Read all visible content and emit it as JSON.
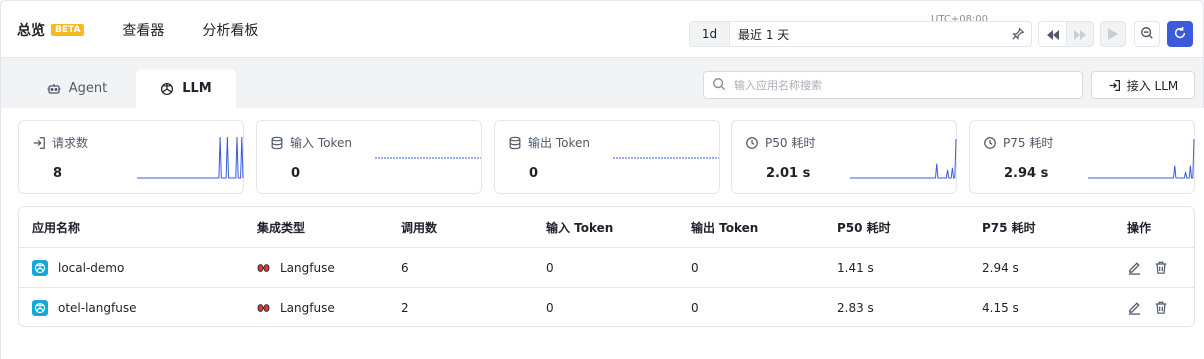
{
  "nav": {
    "tabs": [
      {
        "label": "总览",
        "active": true,
        "badge": "BETA"
      },
      {
        "label": "查看器",
        "active": false
      },
      {
        "label": "分析看板",
        "active": false
      }
    ]
  },
  "time": {
    "timezone": "UTC+08:00",
    "range_short": "1d",
    "range_label": "最近 1 天"
  },
  "subtabs": [
    {
      "label": "Agent",
      "icon": "robot-icon",
      "active": false
    },
    {
      "label": "LLM",
      "icon": "openai-icon",
      "active": true
    }
  ],
  "search": {
    "placeholder": "输入应用名称搜索",
    "value": ""
  },
  "access_button": {
    "label": "接入 LLM",
    "icon": "login-icon"
  },
  "colors": {
    "accent": "#3b5bdb",
    "badge": "#f7ba1e",
    "app_icon": "#14a7d8",
    "spark": "#3b5bdb"
  },
  "cards": [
    {
      "label": "请求数",
      "icon": "login-icon",
      "value": "8",
      "spark": [
        0,
        0,
        0,
        0,
        0,
        0,
        0,
        0,
        0,
        0,
        0,
        0,
        0,
        0,
        0,
        0,
        0,
        0,
        0,
        0,
        0,
        0,
        0,
        0,
        0,
        0,
        0,
        0,
        0,
        0,
        0,
        0,
        0,
        0,
        0,
        0,
        0,
        0,
        0,
        0,
        0,
        0,
        0,
        0,
        0,
        0,
        0,
        0,
        0,
        0,
        0,
        0,
        0,
        0,
        0,
        0,
        0,
        0,
        0,
        0,
        0,
        0,
        0,
        0,
        0,
        0,
        0,
        0,
        0,
        1,
        0,
        0,
        0,
        0,
        0,
        1,
        0,
        0,
        0,
        0,
        0,
        0,
        0,
        1,
        0,
        0,
        0,
        1,
        0
      ]
    },
    {
      "label": "输入 Token",
      "icon": "database-icon",
      "value": "0",
      "spark": []
    },
    {
      "label": "输出 Token",
      "icon": "database-icon",
      "value": "0",
      "spark": []
    },
    {
      "label": "P50 耗时",
      "icon": "clock-icon",
      "value": "2.01 s",
      "spark": [
        0,
        0,
        0,
        0,
        0,
        0,
        0,
        0,
        0,
        0,
        0,
        0,
        0,
        0,
        0,
        0,
        0,
        0,
        0,
        0,
        0,
        0,
        0,
        0,
        0,
        0,
        0,
        0,
        0,
        0,
        0,
        0,
        0,
        0,
        0,
        0,
        0,
        0,
        0,
        0,
        0,
        0,
        0,
        0,
        0,
        0,
        0,
        0,
        0,
        0,
        0,
        0,
        0,
        0,
        0,
        0,
        0,
        0,
        0,
        0,
        0,
        0,
        0,
        0,
        0,
        0,
        0,
        0,
        0,
        0,
        0,
        0,
        0.35,
        0,
        0,
        0,
        0,
        0,
        0,
        0,
        0,
        0.2,
        0,
        0,
        0,
        0.25,
        0,
        0,
        0.95
      ]
    },
    {
      "label": "P75 耗时",
      "icon": "clock-icon",
      "value": "2.94 s",
      "spark": [
        0,
        0,
        0,
        0,
        0,
        0,
        0,
        0,
        0,
        0,
        0,
        0,
        0,
        0,
        0,
        0,
        0,
        0,
        0,
        0,
        0,
        0,
        0,
        0,
        0,
        0,
        0,
        0,
        0,
        0,
        0,
        0,
        0,
        0,
        0,
        0,
        0,
        0,
        0,
        0,
        0,
        0,
        0,
        0,
        0,
        0,
        0,
        0,
        0,
        0,
        0,
        0,
        0,
        0,
        0,
        0,
        0,
        0,
        0,
        0,
        0,
        0,
        0,
        0,
        0,
        0,
        0,
        0,
        0,
        0,
        0,
        0,
        0.3,
        0,
        0,
        0,
        0,
        0,
        0,
        0,
        0,
        0.15,
        0,
        0,
        0,
        0.3,
        0,
        0,
        0.95
      ]
    }
  ],
  "table": {
    "columns": [
      "应用名称",
      "集成类型",
      "调用数",
      "输入 Token",
      "输出 Token",
      "P50 耗时",
      "P75 耗时",
      "操作"
    ],
    "rows": [
      {
        "name": "local-demo",
        "integration": "Langfuse",
        "calls": "6",
        "input_tokens": "0",
        "output_tokens": "0",
        "p50": "1.41 s",
        "p75": "2.94 s"
      },
      {
        "name": "otel-langfuse",
        "integration": "Langfuse",
        "calls": "2",
        "input_tokens": "0",
        "output_tokens": "0",
        "p50": "2.83 s",
        "p75": "4.15 s"
      }
    ]
  }
}
